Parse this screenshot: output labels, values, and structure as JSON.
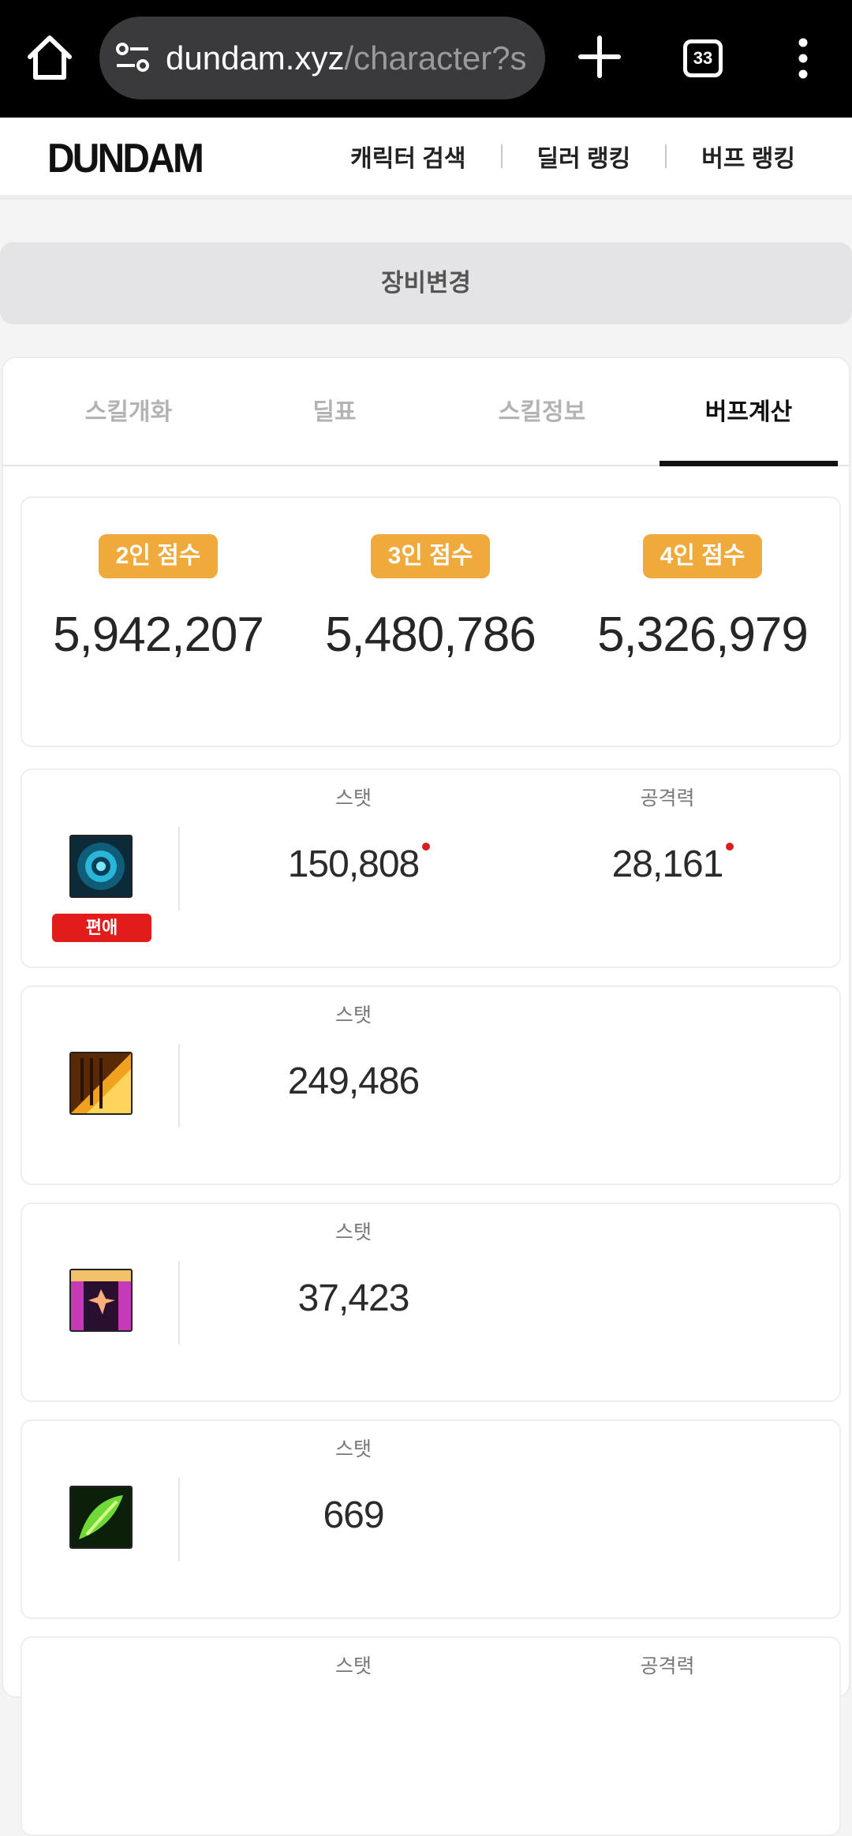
{
  "browser": {
    "url_domain": "dundam.xyz",
    "url_path": "/character?s",
    "tab_count": "33"
  },
  "header": {
    "logo": "DUNDAM",
    "nav": [
      "캐릭터 검색",
      "딜러 랭킹",
      "버프 랭킹"
    ]
  },
  "equip_change_label": "장비변경",
  "tabs": {
    "items": [
      "스킬개화",
      "딜표",
      "스킬정보",
      "버프계산"
    ],
    "active": "버프계산"
  },
  "scores": [
    {
      "label": "2인 점수",
      "value": "5,942,207"
    },
    {
      "label": "3인 점수",
      "value": "5,480,786"
    },
    {
      "label": "4인 점수",
      "value": "5,326,979"
    }
  ],
  "buffs": [
    {
      "icon": "blue-rose-icon",
      "tag": "편애",
      "stats": [
        {
          "label": "스탯",
          "value": "150,808",
          "marked": true
        },
        {
          "label": "공격력",
          "value": "28,161",
          "marked": true
        }
      ]
    },
    {
      "icon": "golden-sword-icon",
      "stats": [
        {
          "label": "스탯",
          "value": "249,486"
        }
      ]
    },
    {
      "icon": "stage-curtain-icon",
      "stats": [
        {
          "label": "스탯",
          "value": "37,423"
        }
      ]
    },
    {
      "icon": "green-leaf-icon",
      "stats": [
        {
          "label": "스탯",
          "value": "669"
        }
      ]
    },
    {
      "stats": [
        {
          "label": "스탯",
          "value": ""
        },
        {
          "label": "공격력",
          "value": ""
        }
      ]
    }
  ],
  "colors": {
    "badge": "#f0a93b",
    "tag": "#e21b1b",
    "marker": "#d81e1e"
  }
}
